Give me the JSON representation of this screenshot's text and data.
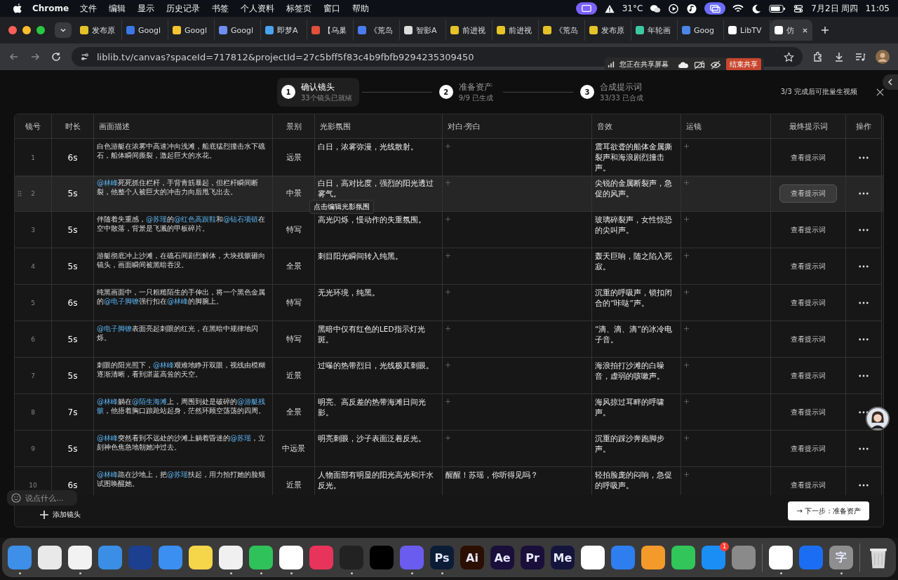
{
  "menu_bar": {
    "app": "Chrome",
    "menus": [
      "文件",
      "编辑",
      "显示",
      "历史记录",
      "书签",
      "个人资料",
      "标签页",
      "窗口",
      "帮助"
    ],
    "temperature": "31°C",
    "date": "7月2日 周四",
    "time": "11:05"
  },
  "tabs": [
    {
      "label": "发布原",
      "color": "#e6c229",
      "selected": false
    },
    {
      "label": "Googl",
      "color": "#3b78e7",
      "selected": false
    },
    {
      "label": "Googl",
      "color": "#f4c430",
      "selected": false
    },
    {
      "label": "Googl",
      "color": "#6f8ff0",
      "selected": false
    },
    {
      "label": "即梦A",
      "color": "#4aa3f0",
      "selected": false
    },
    {
      "label": "【乌巢",
      "color": "#e0503a",
      "selected": false
    },
    {
      "label": "《荒岛",
      "color": "#4a7cf0",
      "selected": false
    },
    {
      "label": "智影A",
      "color": "#dddddd",
      "selected": false
    },
    {
      "label": "前进视",
      "color": "#e6c229",
      "selected": false
    },
    {
      "label": "前进视",
      "color": "#e6c229",
      "selected": false
    },
    {
      "label": "《荒岛",
      "color": "#e6c229",
      "selected": false
    },
    {
      "label": "发布原",
      "color": "#e6c229",
      "selected": false
    },
    {
      "label": "年轮画",
      "color": "#3cc9a0",
      "selected": false
    },
    {
      "label": "Goog",
      "color": "#4a86e8",
      "selected": false
    },
    {
      "label": "LibTV",
      "color": "#ffffff",
      "selected": false
    },
    {
      "label": "仿",
      "color": "#ffffff",
      "selected": true
    }
  ],
  "address": "liblib.tv/canvas?spaceId=717812&projectId=27c5bff5f83c4b9fbfb9294235309450",
  "share_banner": {
    "text": "您正在共享屏幕",
    "button": "结束共享"
  },
  "steps": [
    {
      "number": "1",
      "title": "确认镜头",
      "subtitle": "33个镜头已就绪",
      "selected": true
    },
    {
      "number": "2",
      "title": "准备资产",
      "subtitle": "9/9 已生成",
      "selected": false
    },
    {
      "number": "3",
      "title": "合成提示词",
      "subtitle": "33/33 已合成",
      "selected": false
    }
  ],
  "batch_hint": "3/3 完成后可批量生视频",
  "table": {
    "columns": [
      "镜号",
      "时长",
      "画面描述",
      "景别",
      "光影氛围",
      "对白·旁白",
      "音效",
      "运镜",
      "最终提示词",
      "操作"
    ],
    "rows": [
      {
        "number": "1",
        "duration": "6s",
        "description": [
          {
            "text": "白色游艇在浓雾中高速冲向浅滩，船底猛烈撞击水下礁石，船体瞬间撕裂，激起巨大的水花。",
            "mention": false
          }
        ],
        "shot_size": "远景",
        "lighting": "白日，浓雾弥漫，光线散射。",
        "sound": "震耳欲聋的船体金属撕裂声和海浪剧烈撞击声。",
        "prompt_button": "查看提示词",
        "hovered": false
      },
      {
        "number": "2",
        "duration": "5s",
        "description": [
          {
            "text": "@林峰",
            "mention": true
          },
          {
            "text": "死死抓住栏杆，手背青筋暴起，但栏杆瞬间断裂，他整个人被巨大的冲击力向后甩飞出去。",
            "mention": false
          }
        ],
        "shot_size": "中景",
        "lighting": "白日，高对比度，强烈的阳光透过雾气。",
        "tooltip": "点击编辑光影氛围",
        "sound": "尖锐的金属断裂声，急促的风声。",
        "prompt_button": "查看提示词",
        "hovered": true
      },
      {
        "number": "3",
        "duration": "5s",
        "description": [
          {
            "text": "伴随着失重感，",
            "mention": false
          },
          {
            "text": "@苏瑶",
            "mention": true
          },
          {
            "text": "的",
            "mention": false
          },
          {
            "text": "@红色高跟鞋",
            "mention": true
          },
          {
            "text": "和",
            "mention": false
          },
          {
            "text": "@钻石项链",
            "mention": true
          },
          {
            "text": "在空中散落，背景是飞溅的甲板碎片。",
            "mention": false
          }
        ],
        "shot_size": "特写",
        "lighting": "高光闪烁，慢动作的失重氛围。",
        "sound": "玻璃碎裂声，女性惊恐的尖叫声。",
        "prompt_button": "查看提示词",
        "hovered": false
      },
      {
        "number": "4",
        "duration": "5s",
        "description": [
          {
            "text": "游艇彻底冲上沙滩，在礁石间剧烈解体，大块残骸砸向镜头，画面瞬间被黑暗吞没。",
            "mention": false
          }
        ],
        "shot_size": "全景",
        "lighting": "刺目阳光瞬间转入纯黑。",
        "sound": "轰天巨响，随之陷入死寂。",
        "prompt_button": "查看提示词",
        "hovered": false
      },
      {
        "number": "5",
        "duration": "6s",
        "description": [
          {
            "text": "纯黑画面中，一只粗糙陌生的手伸出，将一个黑色金属的",
            "mention": false
          },
          {
            "text": "@电子脚镣",
            "mention": true
          },
          {
            "text": "强行扣在",
            "mention": false
          },
          {
            "text": "@林峰",
            "mention": true
          },
          {
            "text": "的脚腕上。",
            "mention": false
          }
        ],
        "shot_size": "特写",
        "lighting": "无光环境，纯黑。",
        "sound": "沉重的呼吸声，锁扣闭合的“咔哒”声。",
        "prompt_button": "查看提示词",
        "hovered": false
      },
      {
        "number": "6",
        "duration": "5s",
        "description": [
          {
            "text": "@电子脚镣",
            "mention": true
          },
          {
            "text": "表面亮起刺眼的红光，在黑暗中规律地闪烁。",
            "mention": false
          }
        ],
        "shot_size": "特写",
        "lighting": "黑暗中仅有红色的LED指示灯光斑。",
        "sound": "“滴、滴、滴”的冰冷电子音。",
        "prompt_button": "查看提示词",
        "hovered": false
      },
      {
        "number": "7",
        "duration": "5s",
        "description": [
          {
            "text": "刺眼的阳光照下，",
            "mention": false
          },
          {
            "text": "@林峰",
            "mention": true
          },
          {
            "text": "艰难地睁开双眼，视线由模糊逐渐清晰，看到湛蓝高耸的天空。",
            "mention": false
          }
        ],
        "shot_size": "近景",
        "lighting": "过曝的热带烈日，光线极其刺眼。",
        "sound": "海浪拍打沙滩的白噪音，虚弱的咳嗽声。",
        "prompt_button": "查看提示词",
        "hovered": false
      },
      {
        "number": "8",
        "duration": "7s",
        "description": [
          {
            "text": "@林峰",
            "mention": true
          },
          {
            "text": "躺在",
            "mention": false
          },
          {
            "text": "@陌生海滩",
            "mention": true
          },
          {
            "text": "上，周围到处是破碎的",
            "mention": false
          },
          {
            "text": "@游艇残骸",
            "mention": true
          },
          {
            "text": "，他捂着胸口踉跄站起身，茫然环顾空荡荡的四周。",
            "mention": false
          }
        ],
        "shot_size": "全景",
        "lighting": "明亮、高反差的热带海滩日间光影。",
        "sound": "海风掠过耳畔的呼啸声。",
        "prompt_button": "查看提示词",
        "hovered": false
      },
      {
        "number": "9",
        "duration": "5s",
        "description": [
          {
            "text": "@林峰",
            "mention": true
          },
          {
            "text": "突然看到不远处的沙滩上躺着昏迷的",
            "mention": false
          },
          {
            "text": "@苏瑶",
            "mention": true
          },
          {
            "text": "，立刻神色焦急地朝她冲过去。",
            "mention": false
          }
        ],
        "shot_size": "中远景",
        "lighting": "明亮刺眼，沙子表面泛着反光。",
        "sound": "沉重的踩沙奔跑脚步声。",
        "prompt_button": "查看提示词",
        "hovered": false
      },
      {
        "number": "10",
        "duration": "6s",
        "description": [
          {
            "text": "@林峰",
            "mention": true
          },
          {
            "text": "跪在沙地上，把",
            "mention": false
          },
          {
            "text": "@苏瑶",
            "mention": true
          },
          {
            "text": "扶起，用力拍打她的脸颊试图唤醒她。",
            "mention": false
          }
        ],
        "shot_size": "近景",
        "lighting": "人物面部有明显的阳光高光和汗水反光。",
        "dialogue": "醒醒！苏瑶，你听得见吗？",
        "sound": "轻拍脸庞的闷响，急促的呼吸声。",
        "prompt_button": "查看提示词",
        "hovered": false
      }
    ]
  },
  "add_shot": "添加镜头",
  "next_button": "→ 下一步：准备资产",
  "chat_placeholder": "说点什么...",
  "dock": {
    "apps": [
      {
        "color": "#3d8fe8",
        "running": true
      },
      {
        "color": "#e9e9e9",
        "running": false
      },
      {
        "color": "#f2f2f2",
        "running": true
      },
      {
        "color": "#3a8ee6",
        "running": false
      },
      {
        "color": "#1d3f8f",
        "running": false
      },
      {
        "color": "#3b8ff0",
        "running": false
      },
      {
        "color": "#f5d54a",
        "running": false
      },
      {
        "color": "#f0f0f0",
        "running": true
      },
      {
        "color": "#2fc25b",
        "running": true
      },
      {
        "color": "#ffffff",
        "running": true
      },
      {
        "color": "#e8345a",
        "running": false
      },
      {
        "color": "#222222",
        "running": true
      },
      {
        "color": "#000000",
        "running": false
      },
      {
        "color": "#6b5cf0",
        "running": true
      },
      {
        "color": "#0b1d36",
        "glyph": "Ps",
        "running": true
      },
      {
        "color": "#2b0f00",
        "glyph": "Ai",
        "running": false
      },
      {
        "color": "#1a0f3a",
        "glyph": "Ae",
        "running": false
      },
      {
        "color": "#1a0f3a",
        "glyph": "Pr",
        "running": false
      },
      {
        "color": "#14143d",
        "glyph": "Me",
        "running": false
      },
      {
        "color": "#ffffff",
        "running": false
      },
      {
        "color": "#2f7ef0",
        "running": false
      },
      {
        "color": "#f39a2b",
        "running": false
      },
      {
        "color": "#31c55a",
        "running": false
      },
      {
        "color": "#1a8ef5",
        "badge": "1",
        "running": false
      },
      {
        "color": "#8a8a8a",
        "running": false
      }
    ],
    "recent": [
      {
        "color": "#ffffff",
        "running": true
      },
      {
        "color": "#1b6ef3",
        "running": false
      },
      {
        "color": "#8e8e8e",
        "glyph": "字",
        "running": true
      }
    ]
  }
}
